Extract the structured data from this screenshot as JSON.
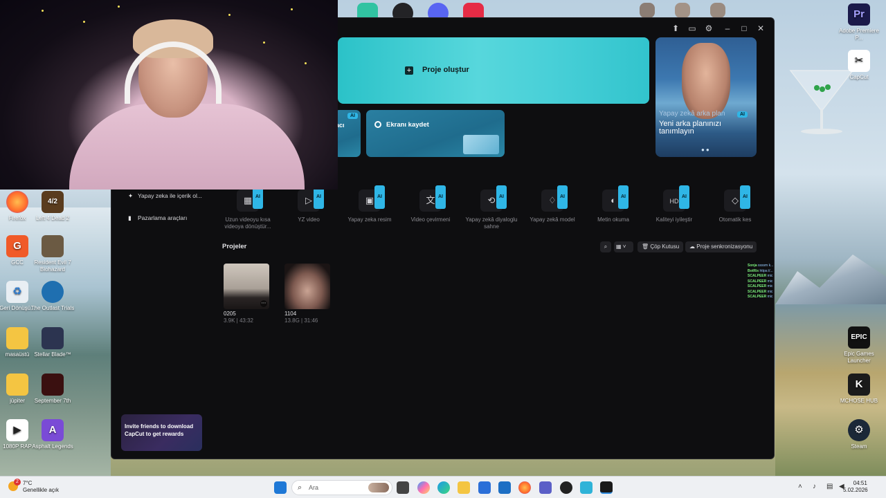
{
  "app": {
    "create_project_label": "Proje oluştur",
    "record_screen_label": "Ekranı kaydet",
    "partial_card_label": "acı",
    "promo_title": "Yapay zekâ arka plan",
    "promo_subtitle": "Yeni arka planınızı tanımlayın",
    "ai_badge": "AI",
    "sidebar": [
      {
        "icon": "sparkle-icon",
        "label": "Yapay zeka ile içerik ol..."
      },
      {
        "icon": "bag-icon",
        "label": "Pazarlama araçları"
      }
    ],
    "tools": [
      {
        "icon": "film-icon",
        "label": "Uzun videoyu kısa videoya dönüştür..."
      },
      {
        "icon": "ai-video-icon",
        "label": "YZ video"
      },
      {
        "icon": "image-icon",
        "label": "Yapay zeka resim"
      },
      {
        "icon": "translate-icon",
        "label": "Video çevirmeni"
      },
      {
        "icon": "dialog-icon",
        "label": "Yapay zekâ diyaloglu sahne"
      },
      {
        "icon": "shirt-icon",
        "label": "Yapay zekâ model"
      },
      {
        "icon": "speech-icon",
        "label": "Metin okuma"
      },
      {
        "icon": "hd-icon",
        "label": "Kaliteyi iyileştir"
      },
      {
        "icon": "eraser-icon",
        "label": "Otomatik kes"
      }
    ],
    "projects_title": "Projeler",
    "trash_label": "Çöp Kutusu",
    "sync_label": "Proje senkronizasyonu",
    "projects": [
      {
        "name": "0205",
        "meta": "3.9K | 43:32"
      },
      {
        "name": "1104",
        "meta": "13.8G | 31:46"
      }
    ],
    "invite_text": "Invite friends to download CapCut to get rewards"
  },
  "desktop_icons_left": [
    {
      "label": "Firefox",
      "icon": "firefox-icon"
    },
    {
      "label": "Left 4 Dead 2",
      "icon": "l4d2-icon"
    },
    {
      "label": "GCC",
      "icon": "gcc-icon"
    },
    {
      "label": "Resident Evil 7 Biohazard",
      "icon": "re7-icon"
    },
    {
      "label": "Geri Dönüşü...",
      "icon": "recycle-bin-icon"
    },
    {
      "label": "The Outlast Trials",
      "icon": "outlast-icon"
    },
    {
      "label": "masaüstü",
      "icon": "folder-icon"
    },
    {
      "label": "Stellar Blade™",
      "icon": "stellar-blade-icon"
    },
    {
      "label": "jüpiter",
      "icon": "folder-icon"
    },
    {
      "label": "September 7th",
      "icon": "game-icon"
    },
    {
      "label": "1080P RAP",
      "icon": "video-file-icon"
    },
    {
      "label": "Asphalt Legends",
      "icon": "asphalt-icon"
    }
  ],
  "desktop_icons_right": [
    {
      "label": "Adobe Premiere P...",
      "icon": "premiere-icon"
    },
    {
      "label": "CapCut",
      "icon": "capcut-icon"
    },
    {
      "label": "Epic Games Launcher",
      "icon": "epic-icon"
    },
    {
      "label": "MCHOSE HUB",
      "icon": "mchose-icon"
    },
    {
      "label": "Steam",
      "icon": "steam-icon"
    }
  ],
  "chat": {
    "lines": [
      {
        "user": "Sonja",
        "text": "ssssm k..."
      },
      {
        "user": "BotRix",
        "text": "https://..."
      },
      {
        "user": "SCALPEER",
        "text": "mic"
      },
      {
        "user": "SCALPEER",
        "text": "mic"
      },
      {
        "user": "SCALPEER",
        "text": "mic"
      },
      {
        "user": "SCALPEER",
        "text": "mic"
      },
      {
        "user": "SCALPEER",
        "text": "mic"
      }
    ]
  },
  "taskbar": {
    "weather_temp": "7°C",
    "weather_desc": "Genellikle açık",
    "weather_badge": "2",
    "search_placeholder": "Ara",
    "time": "04:51",
    "date": "5.02.2026"
  }
}
